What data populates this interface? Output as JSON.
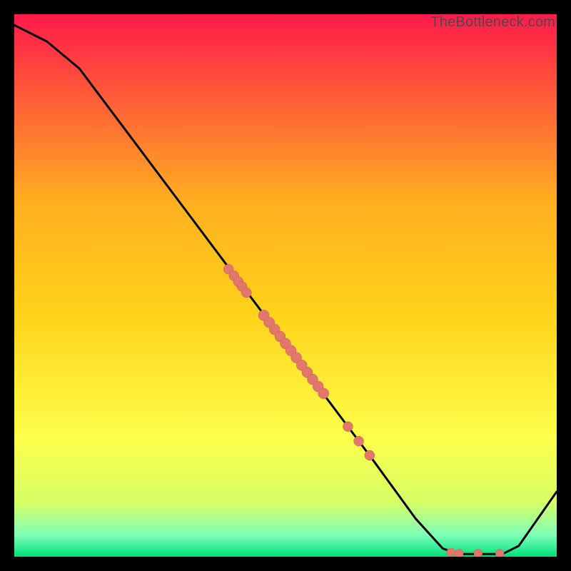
{
  "watermark": "TheBottleneck.com",
  "colors": {
    "gradient_top": "#ff1a4b",
    "gradient_mid_upper": "#ff7a2a",
    "gradient_mid": "#ffd21a",
    "gradient_mid_lower": "#f7ff3a",
    "gradient_low": "#d6ff66",
    "gradient_lower": "#9bffb0",
    "gradient_bottom": "#00e07a",
    "line": "#000000",
    "point_fill": "#e2786b",
    "point_stroke": "#c95a4d",
    "frame": "#000000"
  },
  "chart_data": {
    "type": "line",
    "xlim": [
      0,
      100
    ],
    "ylim": [
      0,
      100
    ],
    "title": "",
    "xlabel": "",
    "ylabel": "",
    "curve": [
      {
        "x": 0,
        "y": 98
      },
      {
        "x": 6,
        "y": 95
      },
      {
        "x": 12,
        "y": 90
      },
      {
        "x": 18,
        "y": 82
      },
      {
        "x": 30,
        "y": 66
      },
      {
        "x": 42,
        "y": 50
      },
      {
        "x": 54,
        "y": 34
      },
      {
        "x": 66,
        "y": 18
      },
      {
        "x": 74,
        "y": 7
      },
      {
        "x": 79,
        "y": 1.5
      },
      {
        "x": 82,
        "y": 0.5
      },
      {
        "x": 90,
        "y": 0.5
      },
      {
        "x": 93,
        "y": 2
      },
      {
        "x": 100,
        "y": 12
      }
    ],
    "points_cluster_upper": [
      {
        "x": 39.5,
        "y": 53.0
      },
      {
        "x": 40.5,
        "y": 51.8
      },
      {
        "x": 41.3,
        "y": 50.7
      },
      {
        "x": 42.0,
        "y": 49.8
      },
      {
        "x": 42.8,
        "y": 48.7
      }
    ],
    "points_cluster_mid": [
      {
        "x": 46.0,
        "y": 44.5
      },
      {
        "x": 47.0,
        "y": 43.2
      },
      {
        "x": 48.0,
        "y": 41.9
      },
      {
        "x": 49.0,
        "y": 40.6
      },
      {
        "x": 50.0,
        "y": 39.3
      },
      {
        "x": 51.0,
        "y": 38.0
      },
      {
        "x": 52.0,
        "y": 36.7
      },
      {
        "x": 53.0,
        "y": 35.3
      },
      {
        "x": 54.0,
        "y": 34.0
      },
      {
        "x": 55.0,
        "y": 32.7
      },
      {
        "x": 56.0,
        "y": 31.4
      },
      {
        "x": 57.0,
        "y": 30.1
      }
    ],
    "points_cluster_lower": [
      {
        "x": 61.5,
        "y": 24.0
      },
      {
        "x": 63.5,
        "y": 21.3
      },
      {
        "x": 65.5,
        "y": 18.7
      }
    ],
    "points_bottom": [
      {
        "x": 80.5,
        "y": 0.8
      },
      {
        "x": 82.0,
        "y": 0.6
      },
      {
        "x": 85.5,
        "y": 0.6
      },
      {
        "x": 89.5,
        "y": 0.6
      }
    ]
  }
}
